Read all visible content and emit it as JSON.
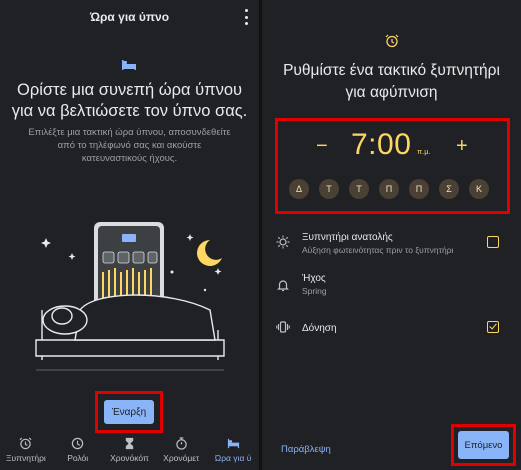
{
  "left": {
    "title": "Ώρα για ύπνο",
    "headline_line1": "Ορίστε μια συνεπή ώρα ύπνου",
    "headline_line2": "για να βελτιώσετε τον ύπνο σας.",
    "description_line1": "Επιλέξτε μια τακτική ώρα ύπνου, αποσυνδεθείτε",
    "description_line2": "από το τηλέφωνό σας και ακούστε",
    "description_line3": "κατευναστικούς ήχους.",
    "start_button": "Έναρξη",
    "nav": [
      {
        "label": "Ξυπνητήρι",
        "icon": "alarm-icon"
      },
      {
        "label": "Ρολόι",
        "icon": "clock-icon"
      },
      {
        "label": "Χρονόκόπ",
        "icon": "hourglass-icon"
      },
      {
        "label": "Χρονόμετ",
        "icon": "stopwatch-icon"
      },
      {
        "label": "Ώρα για ύ",
        "icon": "bed-icon"
      }
    ]
  },
  "right": {
    "headline_line1": "Ρυθμίστε ένα τακτικό ξυπνητήρι",
    "headline_line2": "για αφύπνιση",
    "minus": "−",
    "plus": "+",
    "time": "7:00",
    "ampm": "π.μ.",
    "days": [
      "Δ",
      "Τ",
      "Τ",
      "Π",
      "Π",
      "Σ",
      "Κ"
    ],
    "sunrise": {
      "title": "Ξυπνητήρι ανατολής",
      "subtitle": "Αύξηση φωτεινότητας πριν το ξυπνητήρι",
      "checked": false
    },
    "sound": {
      "title": "Ήχος",
      "subtitle": "Spring"
    },
    "vibration": {
      "title": "Δόνηση",
      "checked": true
    },
    "skip": "Παράβλεψη",
    "next": "Επόμενο"
  },
  "colors": {
    "accent_blue": "#8ab4f8",
    "accent_yellow": "#fdd663",
    "highlight_red": "#e00000",
    "background": "#202124"
  }
}
